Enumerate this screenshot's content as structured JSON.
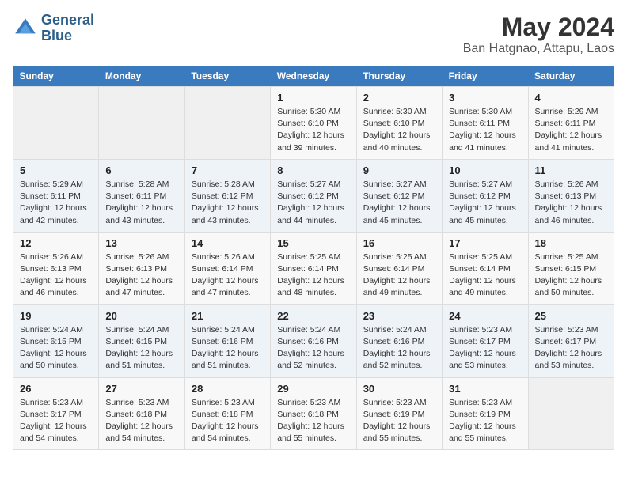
{
  "header": {
    "logo_line1": "General",
    "logo_line2": "Blue",
    "title": "May 2024",
    "subtitle": "Ban Hatgnao, Attapu, Laos"
  },
  "weekdays": [
    "Sunday",
    "Monday",
    "Tuesday",
    "Wednesday",
    "Thursday",
    "Friday",
    "Saturday"
  ],
  "weeks": [
    [
      {
        "day": "",
        "sunrise": "",
        "sunset": "",
        "daylight": ""
      },
      {
        "day": "",
        "sunrise": "",
        "sunset": "",
        "daylight": ""
      },
      {
        "day": "",
        "sunrise": "",
        "sunset": "",
        "daylight": ""
      },
      {
        "day": "1",
        "sunrise": "Sunrise: 5:30 AM",
        "sunset": "Sunset: 6:10 PM",
        "daylight": "Daylight: 12 hours and 39 minutes."
      },
      {
        "day": "2",
        "sunrise": "Sunrise: 5:30 AM",
        "sunset": "Sunset: 6:10 PM",
        "daylight": "Daylight: 12 hours and 40 minutes."
      },
      {
        "day": "3",
        "sunrise": "Sunrise: 5:30 AM",
        "sunset": "Sunset: 6:11 PM",
        "daylight": "Daylight: 12 hours and 41 minutes."
      },
      {
        "day": "4",
        "sunrise": "Sunrise: 5:29 AM",
        "sunset": "Sunset: 6:11 PM",
        "daylight": "Daylight: 12 hours and 41 minutes."
      }
    ],
    [
      {
        "day": "5",
        "sunrise": "Sunrise: 5:29 AM",
        "sunset": "Sunset: 6:11 PM",
        "daylight": "Daylight: 12 hours and 42 minutes."
      },
      {
        "day": "6",
        "sunrise": "Sunrise: 5:28 AM",
        "sunset": "Sunset: 6:11 PM",
        "daylight": "Daylight: 12 hours and 43 minutes."
      },
      {
        "day": "7",
        "sunrise": "Sunrise: 5:28 AM",
        "sunset": "Sunset: 6:12 PM",
        "daylight": "Daylight: 12 hours and 43 minutes."
      },
      {
        "day": "8",
        "sunrise": "Sunrise: 5:27 AM",
        "sunset": "Sunset: 6:12 PM",
        "daylight": "Daylight: 12 hours and 44 minutes."
      },
      {
        "day": "9",
        "sunrise": "Sunrise: 5:27 AM",
        "sunset": "Sunset: 6:12 PM",
        "daylight": "Daylight: 12 hours and 45 minutes."
      },
      {
        "day": "10",
        "sunrise": "Sunrise: 5:27 AM",
        "sunset": "Sunset: 6:12 PM",
        "daylight": "Daylight: 12 hours and 45 minutes."
      },
      {
        "day": "11",
        "sunrise": "Sunrise: 5:26 AM",
        "sunset": "Sunset: 6:13 PM",
        "daylight": "Daylight: 12 hours and 46 minutes."
      }
    ],
    [
      {
        "day": "12",
        "sunrise": "Sunrise: 5:26 AM",
        "sunset": "Sunset: 6:13 PM",
        "daylight": "Daylight: 12 hours and 46 minutes."
      },
      {
        "day": "13",
        "sunrise": "Sunrise: 5:26 AM",
        "sunset": "Sunset: 6:13 PM",
        "daylight": "Daylight: 12 hours and 47 minutes."
      },
      {
        "day": "14",
        "sunrise": "Sunrise: 5:26 AM",
        "sunset": "Sunset: 6:14 PM",
        "daylight": "Daylight: 12 hours and 47 minutes."
      },
      {
        "day": "15",
        "sunrise": "Sunrise: 5:25 AM",
        "sunset": "Sunset: 6:14 PM",
        "daylight": "Daylight: 12 hours and 48 minutes."
      },
      {
        "day": "16",
        "sunrise": "Sunrise: 5:25 AM",
        "sunset": "Sunset: 6:14 PM",
        "daylight": "Daylight: 12 hours and 49 minutes."
      },
      {
        "day": "17",
        "sunrise": "Sunrise: 5:25 AM",
        "sunset": "Sunset: 6:14 PM",
        "daylight": "Daylight: 12 hours and 49 minutes."
      },
      {
        "day": "18",
        "sunrise": "Sunrise: 5:25 AM",
        "sunset": "Sunset: 6:15 PM",
        "daylight": "Daylight: 12 hours and 50 minutes."
      }
    ],
    [
      {
        "day": "19",
        "sunrise": "Sunrise: 5:24 AM",
        "sunset": "Sunset: 6:15 PM",
        "daylight": "Daylight: 12 hours and 50 minutes."
      },
      {
        "day": "20",
        "sunrise": "Sunrise: 5:24 AM",
        "sunset": "Sunset: 6:15 PM",
        "daylight": "Daylight: 12 hours and 51 minutes."
      },
      {
        "day": "21",
        "sunrise": "Sunrise: 5:24 AM",
        "sunset": "Sunset: 6:16 PM",
        "daylight": "Daylight: 12 hours and 51 minutes."
      },
      {
        "day": "22",
        "sunrise": "Sunrise: 5:24 AM",
        "sunset": "Sunset: 6:16 PM",
        "daylight": "Daylight: 12 hours and 52 minutes."
      },
      {
        "day": "23",
        "sunrise": "Sunrise: 5:24 AM",
        "sunset": "Sunset: 6:16 PM",
        "daylight": "Daylight: 12 hours and 52 minutes."
      },
      {
        "day": "24",
        "sunrise": "Sunrise: 5:23 AM",
        "sunset": "Sunset: 6:17 PM",
        "daylight": "Daylight: 12 hours and 53 minutes."
      },
      {
        "day": "25",
        "sunrise": "Sunrise: 5:23 AM",
        "sunset": "Sunset: 6:17 PM",
        "daylight": "Daylight: 12 hours and 53 minutes."
      }
    ],
    [
      {
        "day": "26",
        "sunrise": "Sunrise: 5:23 AM",
        "sunset": "Sunset: 6:17 PM",
        "daylight": "Daylight: 12 hours and 54 minutes."
      },
      {
        "day": "27",
        "sunrise": "Sunrise: 5:23 AM",
        "sunset": "Sunset: 6:18 PM",
        "daylight": "Daylight: 12 hours and 54 minutes."
      },
      {
        "day": "28",
        "sunrise": "Sunrise: 5:23 AM",
        "sunset": "Sunset: 6:18 PM",
        "daylight": "Daylight: 12 hours and 54 minutes."
      },
      {
        "day": "29",
        "sunrise": "Sunrise: 5:23 AM",
        "sunset": "Sunset: 6:18 PM",
        "daylight": "Daylight: 12 hours and 55 minutes."
      },
      {
        "day": "30",
        "sunrise": "Sunrise: 5:23 AM",
        "sunset": "Sunset: 6:19 PM",
        "daylight": "Daylight: 12 hours and 55 minutes."
      },
      {
        "day": "31",
        "sunrise": "Sunrise: 5:23 AM",
        "sunset": "Sunset: 6:19 PM",
        "daylight": "Daylight: 12 hours and 55 minutes."
      },
      {
        "day": "",
        "sunrise": "",
        "sunset": "",
        "daylight": ""
      }
    ]
  ]
}
